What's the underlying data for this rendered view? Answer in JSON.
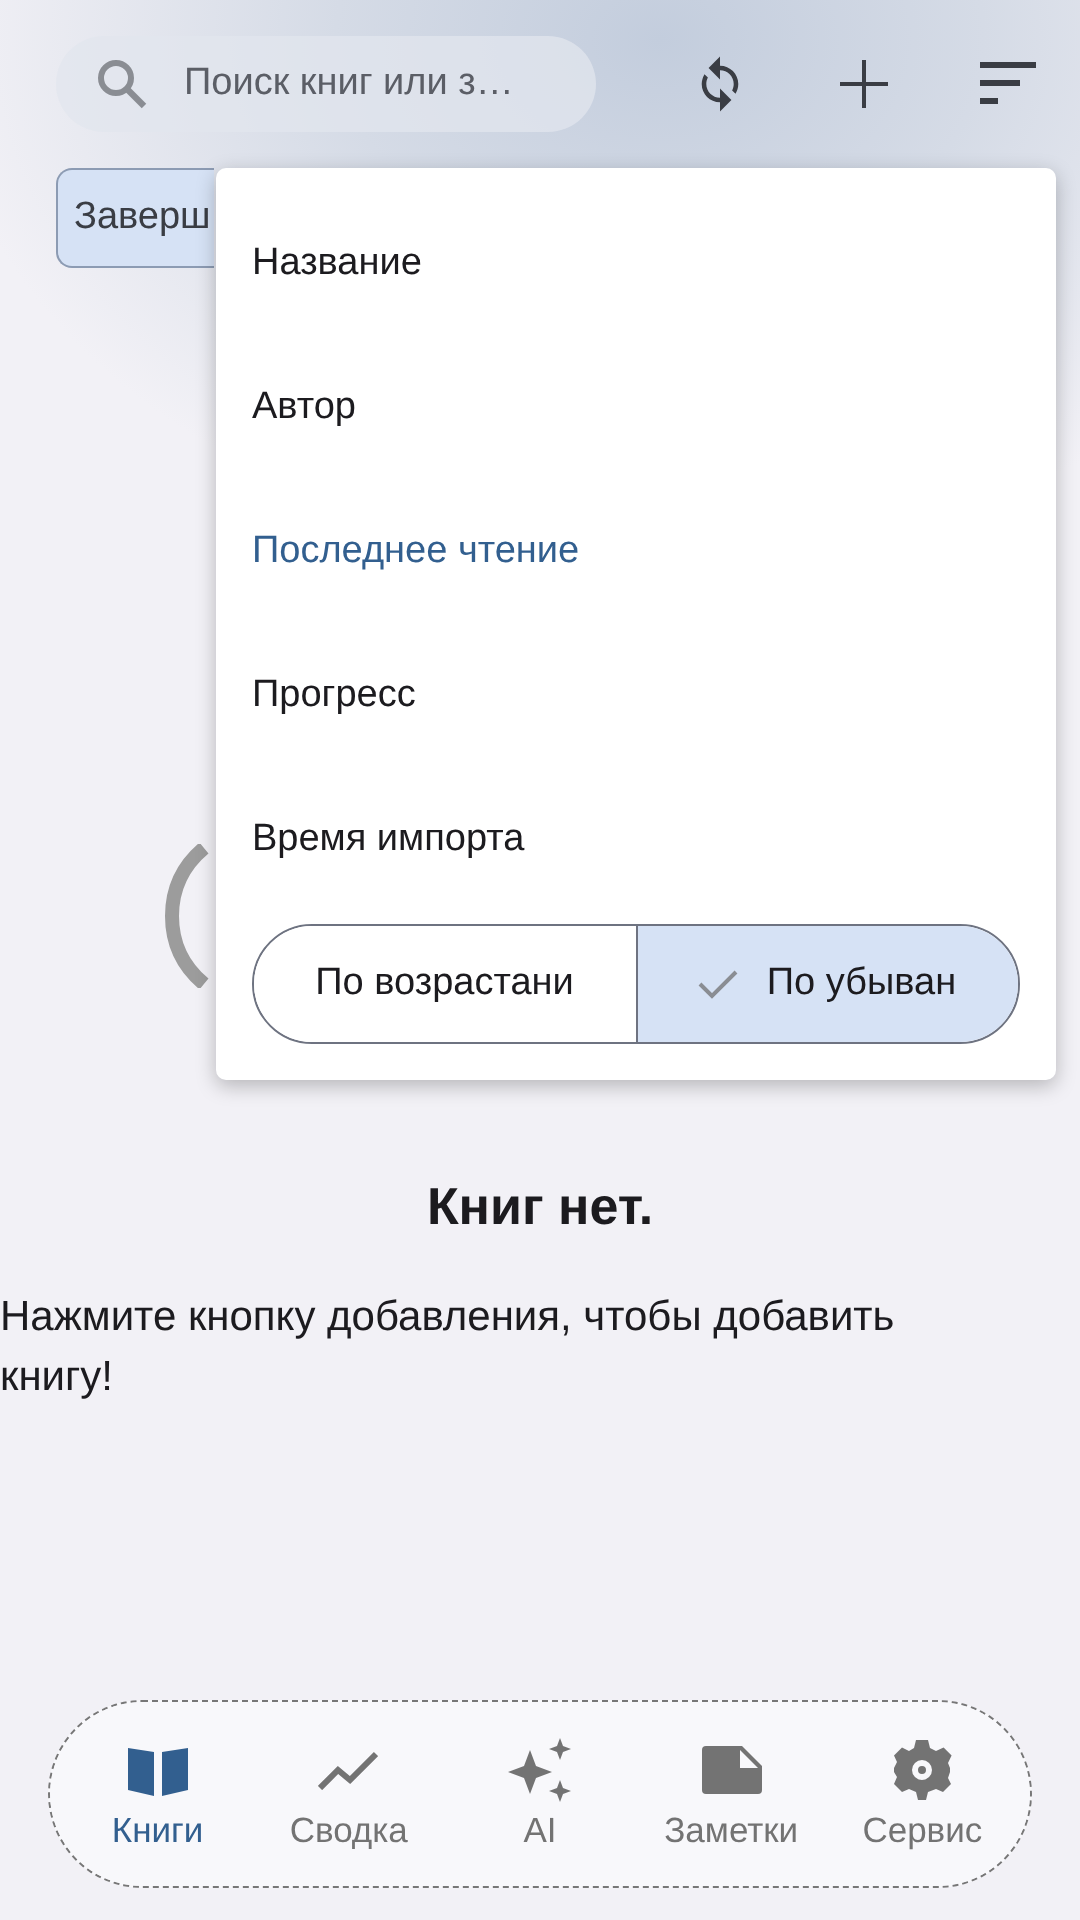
{
  "search": {
    "placeholder": "Поиск книг или з…"
  },
  "toolbar": [
    {
      "kind": "sync"
    },
    {
      "kind": "add"
    },
    {
      "kind": "sort"
    }
  ],
  "filter_chip": {
    "label": "Заверш",
    "selected": true
  },
  "sort_menu": {
    "items": [
      {
        "label": "Название",
        "selected": false
      },
      {
        "label": "Автор",
        "selected": false
      },
      {
        "label": "Последнее чтение",
        "selected": true
      },
      {
        "label": "Прогресс",
        "selected": false
      },
      {
        "label": "Время импорта",
        "selected": false
      }
    ],
    "order": [
      {
        "label": "По возрастани",
        "selected": false
      },
      {
        "label": "По убыван",
        "selected": true
      }
    ]
  },
  "empty": {
    "title": "Книг нет.",
    "message": "Нажмите кнопку добавления, чтобы добавить книгу!"
  },
  "nav": [
    {
      "label": "Книги",
      "kind": "book",
      "selected": true
    },
    {
      "label": "Сводка",
      "kind": "trend",
      "selected": false
    },
    {
      "label": "AI",
      "kind": "sparkle",
      "selected": false
    },
    {
      "label": "Заметки",
      "kind": "note",
      "selected": false
    },
    {
      "label": "Сервис",
      "kind": "gear",
      "selected": false
    }
  ]
}
